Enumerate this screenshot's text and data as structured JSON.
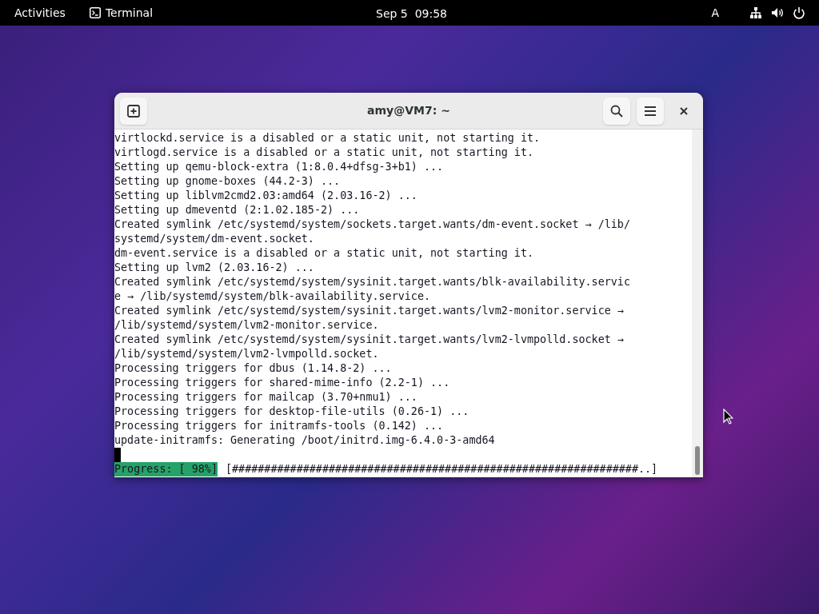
{
  "top_bar": {
    "activities": "Activities",
    "app_name": "Terminal",
    "clock": "Sep 5  09:58",
    "input_source": "A"
  },
  "window": {
    "title": "amy@VM7: ~",
    "lines": [
      "virtlockd.service is a disabled or a static unit, not starting it.",
      "virtlogd.service is a disabled or a static unit, not starting it.",
      "Setting up qemu-block-extra (1:8.0.4+dfsg-3+b1) ...",
      "Setting up gnome-boxes (44.2-3) ...",
      "Setting up liblvm2cmd2.03:amd64 (2.03.16-2) ...",
      "Setting up dmeventd (2:1.02.185-2) ...",
      "Created symlink /etc/systemd/system/sockets.target.wants/dm-event.socket → /lib/",
      "systemd/system/dm-event.socket.",
      "dm-event.service is a disabled or a static unit, not starting it.",
      "Setting up lvm2 (2.03.16-2) ...",
      "Created symlink /etc/systemd/system/sysinit.target.wants/blk-availability.servic",
      "e → /lib/systemd/system/blk-availability.service.",
      "Created symlink /etc/systemd/system/sysinit.target.wants/lvm2-monitor.service →",
      "/lib/systemd/system/lvm2-monitor.service.",
      "Created symlink /etc/systemd/system/sysinit.target.wants/lvm2-lvmpolld.socket →",
      "/lib/systemd/system/lvm2-lvmpolld.socket.",
      "Processing triggers for dbus (1.14.8-2) ...",
      "Processing triggers for shared-mime-info (2.2-1) ...",
      "Processing triggers for mailcap (3.70+nmu1) ...",
      "Processing triggers for desktop-file-utils (0.26-1) ...",
      "Processing triggers for initramfs-tools (0.142) ...",
      "update-initramfs: Generating /boot/initrd.img-6.4.0-3-amd64"
    ],
    "progress_label": "Progress: [ 98%]",
    "progress_bar": "[###############################################################..]"
  }
}
